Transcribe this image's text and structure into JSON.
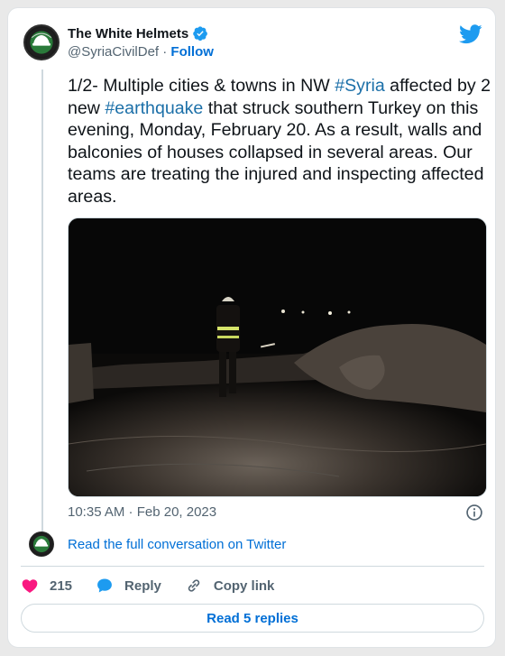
{
  "account": {
    "display_name": "The White Helmets",
    "handle": "@SyriaCivilDef",
    "separator": "·",
    "follow_label": "Follow"
  },
  "tweet": {
    "text_parts": [
      "1/2- Multiple cities & towns in NW ",
      "#Syria",
      " affected by 2 new ",
      "#earthquake",
      " that struck southern Turkey on this evening, Monday, February 20. As a result, walls and balconies of houses collapsed in several areas. Our teams are treating the injured and inspecting affected areas."
    ],
    "timestamp": "10:35 AM · Feb 20, 2023"
  },
  "links": {
    "read_conversation": "Read the full conversation on Twitter"
  },
  "actions": {
    "like_count": "215",
    "reply_label": "Reply",
    "copy_link_label": "Copy link",
    "read_replies_label": "Read 5 replies"
  },
  "icons": {
    "verified": "verified-badge-icon",
    "platform": "twitter-bird-icon",
    "info": "info-icon",
    "like": "heart-icon",
    "reply": "reply-bubble-icon",
    "copy": "link-icon"
  },
  "colors": {
    "accent": "#006fd6",
    "hashtag": "#1b6fa8",
    "heart": "#f91880",
    "reply_blue": "#1d9bf0"
  }
}
